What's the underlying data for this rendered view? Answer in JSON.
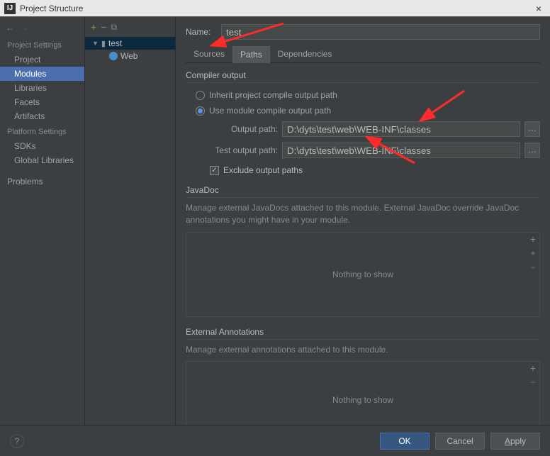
{
  "window": {
    "title": "Project Structure"
  },
  "sidebar": {
    "heading1": "Project Settings",
    "items1": [
      "Project",
      "Modules",
      "Libraries",
      "Facets",
      "Artifacts"
    ],
    "heading2": "Platform Settings",
    "items2": [
      "SDKs",
      "Global Libraries"
    ],
    "problems": "Problems"
  },
  "tree": {
    "root": "test",
    "child": "Web"
  },
  "content": {
    "name_label": "Name:",
    "name_value": "test",
    "tabs": [
      "Sources",
      "Paths",
      "Dependencies"
    ],
    "compiler": {
      "title": "Compiler output",
      "radio_inherit": "Inherit project compile output path",
      "radio_module": "Use module compile output path",
      "output_label": "Output path:",
      "output_value": "D:\\dyts\\test\\web\\WEB-INF\\classes",
      "test_label": "Test output path:",
      "test_value": "D:\\dyts\\test\\web\\WEB-INF\\classes",
      "exclude_label": "Exclude output paths"
    },
    "javadoc": {
      "title": "JavaDoc",
      "desc": "Manage external JavaDocs attached to this module. External JavaDoc override JavaDoc annotations you might have in your module.",
      "empty": "Nothing to show"
    },
    "annotations": {
      "title": "External Annotations",
      "desc": "Manage external annotations attached to this module.",
      "empty": "Nothing to show"
    }
  },
  "footer": {
    "ok": "OK",
    "cancel": "Cancel",
    "apply": "Apply"
  }
}
